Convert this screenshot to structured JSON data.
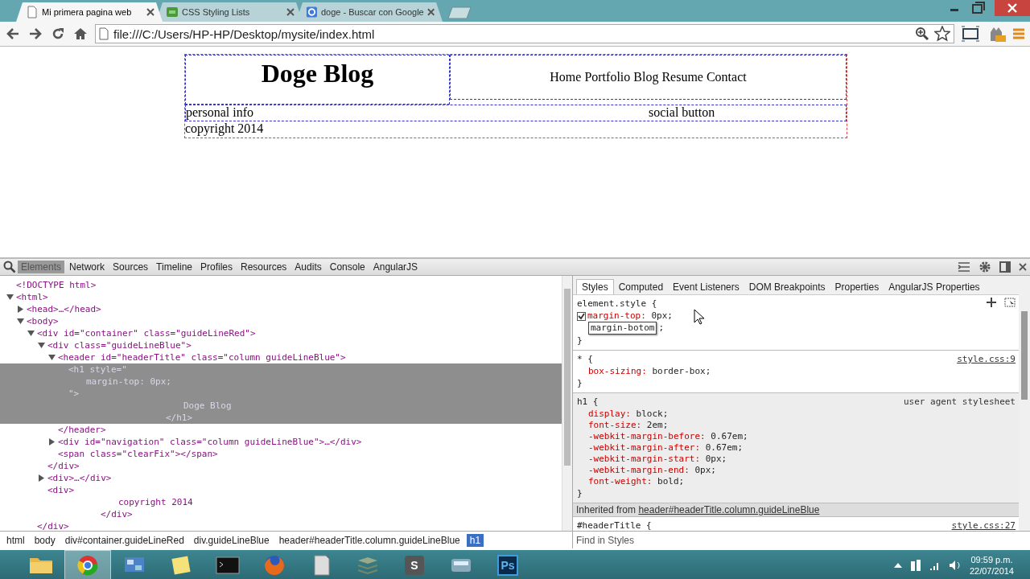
{
  "browser": {
    "tabs": [
      {
        "title": "Mi primera pagina web",
        "selected": true,
        "kind": "page"
      },
      {
        "title": "CSS Styling Lists",
        "selected": false,
        "kind": "site"
      },
      {
        "title": "doge - Buscar con Google",
        "selected": false,
        "kind": "search"
      }
    ],
    "url": "file:///C:/Users/HP-HP/Desktop/mysite/index.html"
  },
  "page": {
    "title": "Doge Blog",
    "nav": "Home Portfolio Blog Resume Contact",
    "left": "personal info",
    "right": "social button",
    "footer": "copyright 2014"
  },
  "devtools": {
    "panels": [
      {
        "label": "Elements",
        "selected": true
      },
      {
        "label": "Network",
        "selected": false
      },
      {
        "label": "Sources",
        "selected": false
      },
      {
        "label": "Timeline",
        "selected": false
      },
      {
        "label": "Profiles",
        "selected": false
      },
      {
        "label": "Resources",
        "selected": false
      },
      {
        "label": "Audits",
        "selected": false
      },
      {
        "label": "Console",
        "selected": false
      },
      {
        "label": "AngularJS",
        "selected": false
      }
    ],
    "dom_tree": [
      {
        "lines": [
          "<!DOCTYPE html>"
        ],
        "selected": false
      },
      {
        "lines": [
          "<html>"
        ],
        "expanded": true,
        "selected": false,
        "children": [
          {
            "lines": [
              "<head>…</head>"
            ],
            "expanded": false,
            "selected": false
          },
          {
            "lines": [
              "<body>"
            ],
            "expanded": true,
            "selected": false,
            "children": [
              {
                "lines": [
                  "<div id=\"container\" class=\"guideLineRed\">"
                ],
                "expanded": true,
                "selected": false,
                "closing": "</div>",
                "children": [
                  {
                    "lines": [
                      "<div class=\"guideLineBlue\">"
                    ],
                    "expanded": true,
                    "selected": false,
                    "closing": "</div>",
                    "children": [
                      {
                        "lines": [
                          "<header id=\"headerTitle\" class=\"column guideLineBlue\">"
                        ],
                        "expanded": true,
                        "selected": false,
                        "closing": "</header>",
                        "children": [
                          {
                            "lines": [
                              "<h1 style=\"",
                              "margin-top: 0px;",
                              "\">",
                              "Doge Blog",
                              "</h1>"
                            ],
                            "selected": true
                          }
                        ]
                      },
                      {
                        "lines": [
                          "<div id=\"navigation\" class=\"column guideLineBlue\">…</div>"
                        ],
                        "expanded": false,
                        "selected": false
                      },
                      {
                        "lines": [
                          "<span class=\"clearFix\"></span>"
                        ],
                        "selected": false
                      }
                    ]
                  },
                  {
                    "lines": [
                      "<div>…</div>"
                    ],
                    "expanded": false,
                    "selected": false
                  },
                  {
                    "lines": [
                      "<div>",
                      "copyright 2014",
                      "</div>"
                    ],
                    "selected": false
                  }
                ]
              }
            ]
          }
        ]
      }
    ],
    "breadcrumbs": [
      {
        "label": "html",
        "selected": false
      },
      {
        "label": "body",
        "selected": false
      },
      {
        "label": "div#container.guideLineRed",
        "selected": false
      },
      {
        "label": "div.guideLineBlue",
        "selected": false
      },
      {
        "label": "header#headerTitle.column.guideLineBlue",
        "selected": false
      },
      {
        "label": "h1",
        "selected": true
      }
    ],
    "sidebar_tabs": [
      {
        "label": "Styles",
        "selected": true
      },
      {
        "label": "Computed",
        "selected": false
      },
      {
        "label": "Event Listeners",
        "selected": false
      },
      {
        "label": "DOM Breakpoints",
        "selected": false
      },
      {
        "label": "Properties",
        "selected": false
      },
      {
        "label": "AngularJS Properties",
        "selected": false
      }
    ],
    "rules": [
      {
        "kind": "element",
        "selector": "element.style {",
        "close": "}",
        "declarations": [
          {
            "kind": "decl",
            "property": "margin-top:",
            "value": "0px;",
            "checked": true
          },
          {
            "kind": "editing",
            "property": "margin-botom",
            "value": ";"
          }
        ]
      },
      {
        "kind": "author",
        "selector": "* {",
        "source": "style.css:9",
        "close": "}",
        "declarations": [
          {
            "kind": "decl",
            "property": "box-sizing:",
            "value": "border-box;"
          }
        ]
      },
      {
        "kind": "useragent",
        "selector": "h1 {",
        "source": "user agent stylesheet",
        "close": "}",
        "declarations": [
          {
            "kind": "decl",
            "property": "display:",
            "value": "block;"
          },
          {
            "kind": "decl",
            "property": "font-size:",
            "value": "2em;"
          },
          {
            "kind": "decl",
            "property": "-webkit-margin-before:",
            "value": "0.67em;"
          },
          {
            "kind": "decl",
            "property": "-webkit-margin-after:",
            "value": "0.67em;"
          },
          {
            "kind": "decl",
            "property": "-webkit-margin-start:",
            "value": "0px;"
          },
          {
            "kind": "decl",
            "property": "-webkit-margin-end:",
            "value": "0px;"
          },
          {
            "kind": "decl",
            "property": "font-weight:",
            "value": "bold;"
          }
        ]
      },
      {
        "kind": "inherited",
        "label": "Inherited from",
        "link": "header#headerTitle.column.guideLineBlue"
      },
      {
        "kind": "author",
        "selector": "#headerTitle {",
        "source": "style.css:27"
      }
    ],
    "find_placeholder": "Find in Styles"
  },
  "taskbar": {
    "apps": [
      {
        "kind": "folder",
        "selected": false
      },
      {
        "kind": "chrome",
        "selected": true
      },
      {
        "kind": "panel",
        "selected": false
      },
      {
        "kind": "notes",
        "selected": false
      },
      {
        "kind": "cmd",
        "selected": false
      },
      {
        "kind": "firefox",
        "selected": false
      },
      {
        "kind": "paper",
        "selected": false
      },
      {
        "kind": "stack",
        "selected": false
      },
      {
        "kind": "letter",
        "label": "S",
        "selected": false
      },
      {
        "kind": "drive",
        "selected": false
      },
      {
        "kind": "photoshop",
        "label": "Ps",
        "selected": false
      }
    ],
    "time": "09:59 p.m.",
    "date": "22/07/2014"
  }
}
